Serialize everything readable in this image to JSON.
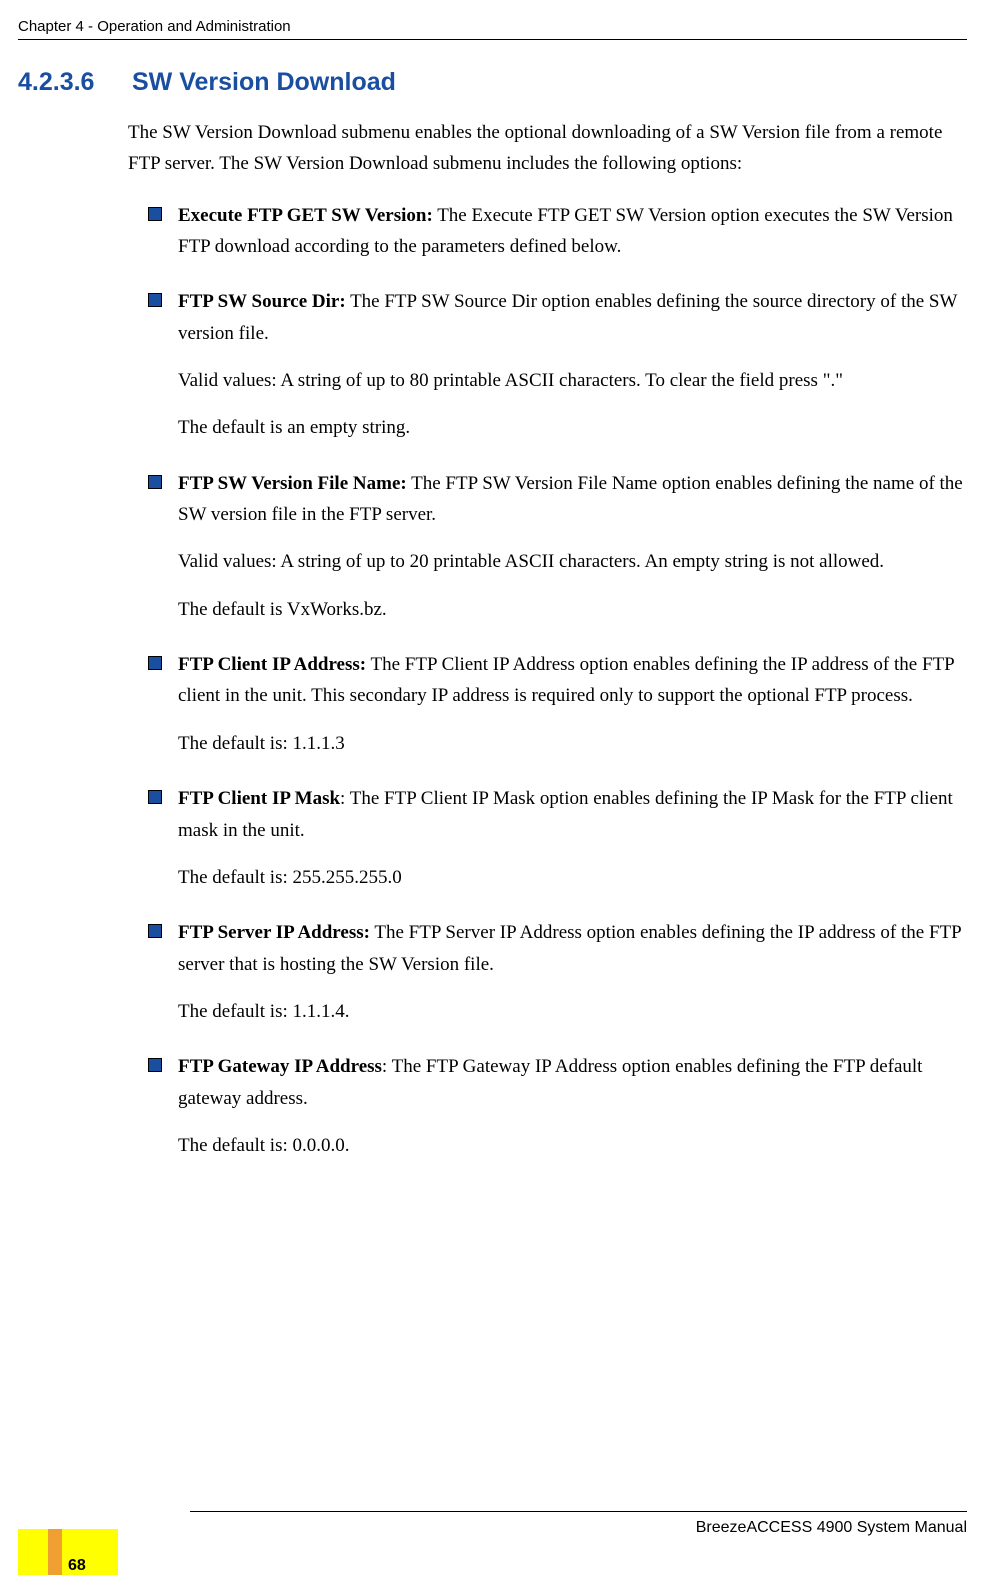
{
  "header": {
    "chapter": "Chapter 4 - Operation and Administration"
  },
  "section": {
    "number": "4.2.3.6",
    "title": "SW Version Download",
    "intro": "The SW Version Download submenu enables the optional downloading of a SW Version file from a remote FTP server. The SW Version Download submenu includes the following options:"
  },
  "items": [
    {
      "label": "Execute FTP GET SW Version:",
      "text": " The Execute FTP GET SW Version option executes the SW Version FTP download according to the parameters defined below.",
      "paras": []
    },
    {
      "label": "FTP SW Source Dir:",
      "text": " The FTP SW Source Dir option enables defining the source directory of the SW version file.",
      "paras": [
        "Valid values: A string of up to 80 printable ASCII characters. To clear the field press \".\"",
        "The default is an empty string."
      ]
    },
    {
      "label": "FTP SW Version File Name:",
      "text": " The FTP SW Version File Name option enables defining the name of the SW version file in the FTP server.",
      "paras": [
        "Valid values: A string of up to 20 printable ASCII characters. An empty string is not allowed.",
        "The default is VxWorks.bz."
      ]
    },
    {
      "label": "FTP Client IP Address:",
      "text": " The FTP Client IP Address option enables defining the IP address of the FTP client in the unit. This secondary IP address is required only to support the optional FTP process.",
      "paras": [
        "The default is: 1.1.1.3"
      ]
    },
    {
      "label": "FTP Client IP Mask",
      "text": ": The FTP Client IP Mask option enables defining the IP Mask for the FTP client mask in the unit.",
      "paras": [
        "The default is: 255.255.255.0"
      ]
    },
    {
      "label": "FTP Server IP Address:",
      "text": " The FTP Server IP Address option enables defining the IP address of the FTP server that is hosting the SW Version file.",
      "paras": [
        "The default is: 1.1.1.4."
      ]
    },
    {
      "label": "FTP Gateway IP Address",
      "text": ": The FTP Gateway IP Address option enables defining the FTP default gateway address.",
      "paras": [
        "The default is: 0.0.0.0."
      ]
    }
  ],
  "footer": {
    "manual": "BreezeACCESS 4900 System Manual",
    "page": "68"
  }
}
